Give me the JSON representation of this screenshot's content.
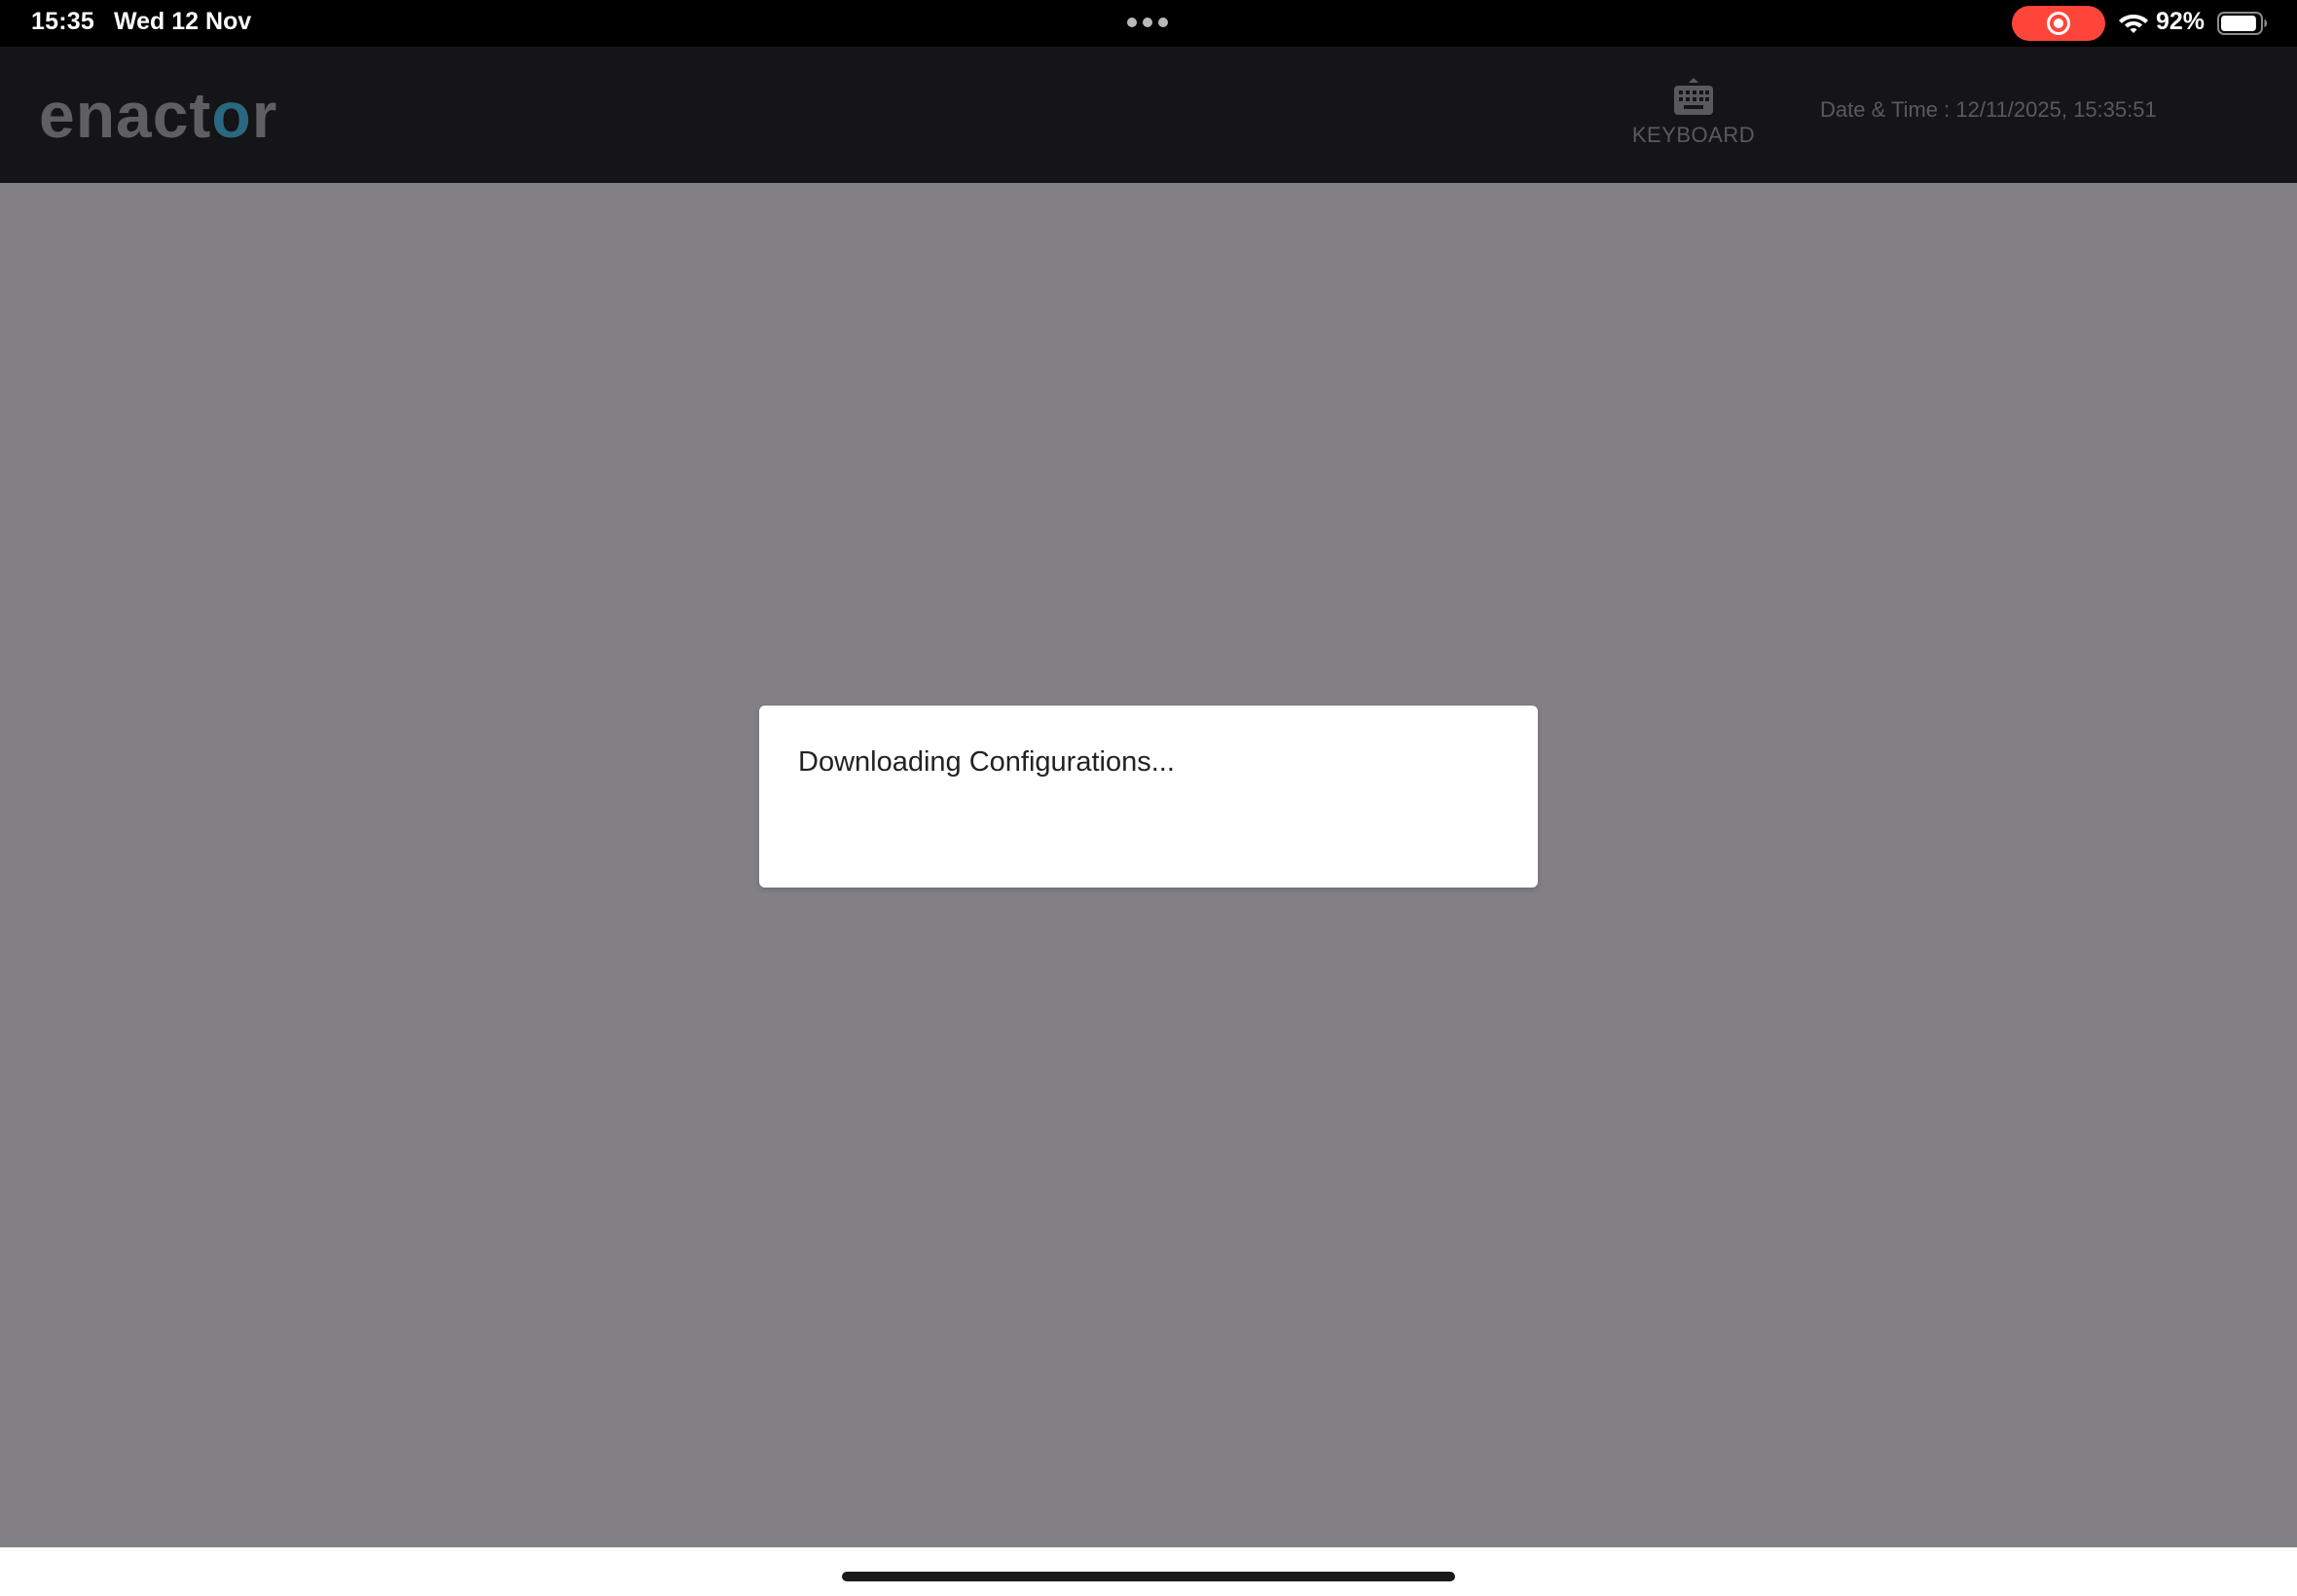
{
  "status_bar": {
    "time": "15:35",
    "date": "Wed 12 Nov",
    "battery_percent": "92%",
    "battery_level": 0.92,
    "recording_color": "#ff453a",
    "icons": [
      "multitask-dots-icon",
      "screen-record-icon",
      "wifi-icon",
      "battery-icon"
    ]
  },
  "header": {
    "logo": {
      "text_start": "enact",
      "text_accent": "o",
      "text_end": "r",
      "accent_color": "#2a6880"
    },
    "keyboard_button": {
      "icon": "keyboard-icon",
      "label": "KEYBOARD"
    },
    "datetime": "Date & Time : 12/11/2025, 15:35:51"
  },
  "dialog": {
    "message": "Downloading Configurations..."
  },
  "colors": {
    "header_bg": "#151417",
    "overlay_bg": "#828085",
    "dialog_bg": "#ffffff"
  }
}
